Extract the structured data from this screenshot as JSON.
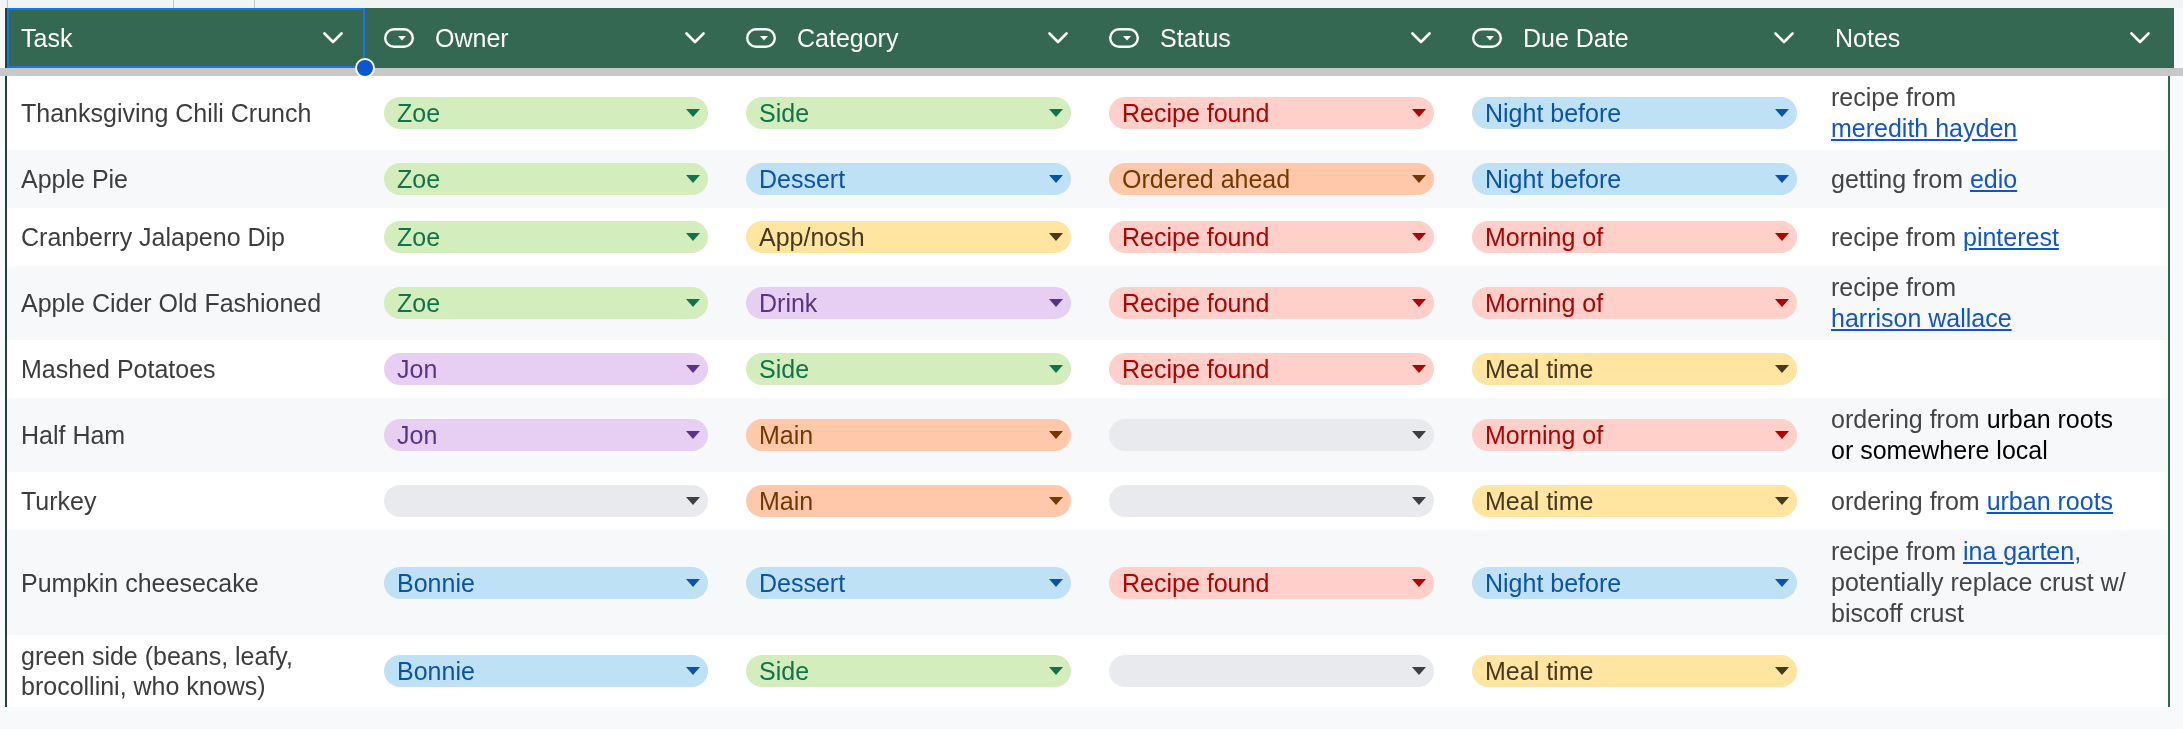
{
  "columns": [
    {
      "label": "Task",
      "kind": "text",
      "selected": true
    },
    {
      "label": "Owner",
      "kind": "dropdown",
      "selected": false
    },
    {
      "label": "Category",
      "kind": "dropdown",
      "selected": false
    },
    {
      "label": "Status",
      "kind": "dropdown",
      "selected": false
    },
    {
      "label": "Due Date",
      "kind": "dropdown",
      "selected": false
    },
    {
      "label": "Notes",
      "kind": "text",
      "selected": false
    }
  ],
  "rows": [
    {
      "task": "Thanksgiving Chili Crunch",
      "owner": {
        "label": "Zoe",
        "color": "#d4edbc"
      },
      "category": {
        "label": "Side",
        "color": "#d4edbc"
      },
      "status": {
        "label": "Recipe found",
        "color": "#ffcfc9"
      },
      "due_date": {
        "label": "Night before",
        "color": "#bfe1f6"
      },
      "notes": [
        {
          "kind": "text",
          "text": "recipe from "
        },
        {
          "kind": "link",
          "text": "meredith hayden"
        }
      ]
    },
    {
      "task": "Apple Pie",
      "owner": {
        "label": "Zoe",
        "color": "#d4edbc"
      },
      "category": {
        "label": "Dessert",
        "color": "#bfe1f6"
      },
      "status": {
        "label": "Ordered ahead",
        "color": "#ffc8aa"
      },
      "due_date": {
        "label": "Night before",
        "color": "#bfe1f6"
      },
      "notes": [
        {
          "kind": "text",
          "text": "getting from "
        },
        {
          "kind": "link",
          "text": "edio"
        }
      ]
    },
    {
      "task": "Cranberry Jalapeno Dip",
      "owner": {
        "label": "Zoe",
        "color": "#d4edbc"
      },
      "category": {
        "label": "App/nosh",
        "color": "#ffe5a0"
      },
      "status": {
        "label": "Recipe found",
        "color": "#ffcfc9"
      },
      "due_date": {
        "label": "Morning of",
        "color": "#ffcfc9"
      },
      "notes": [
        {
          "kind": "text",
          "text": "recipe from "
        },
        {
          "kind": "link",
          "text": "pinterest"
        }
      ]
    },
    {
      "task": "Apple Cider Old Fashioned",
      "owner": {
        "label": "Zoe",
        "color": "#d4edbc"
      },
      "category": {
        "label": "Drink",
        "color": "#e6cff2"
      },
      "status": {
        "label": "Recipe found",
        "color": "#ffcfc9"
      },
      "due_date": {
        "label": "Morning of",
        "color": "#ffcfc9"
      },
      "notes": [
        {
          "kind": "text",
          "text": "recipe from "
        },
        {
          "kind": "link",
          "text": "harrison wallace"
        }
      ]
    },
    {
      "task": "Mashed Potatoes",
      "owner": {
        "label": "Jon",
        "color": "#e6cff2"
      },
      "category": {
        "label": "Side",
        "color": "#d4edbc"
      },
      "status": {
        "label": "Recipe found",
        "color": "#ffcfc9"
      },
      "due_date": {
        "label": "Meal time",
        "color": "#ffe5a0"
      }
    },
    {
      "task": "Half Ham",
      "owner": {
        "label": "Jon",
        "color": "#e6cff2"
      },
      "category": {
        "label": "Main",
        "color": "#ffc8aa"
      },
      "status": {
        "color": "#e8eaed"
      },
      "due_date": {
        "label": "Morning of",
        "color": "#ffcfc9"
      },
      "notes": [
        {
          "kind": "text",
          "text": "ordering from "
        },
        {
          "kind": "dark",
          "text": "urban roots or somewhere local"
        }
      ]
    },
    {
      "task": "Turkey",
      "owner": {
        "color": "#e8eaed"
      },
      "category": {
        "label": "Main",
        "color": "#ffc8aa"
      },
      "status": {
        "color": "#e8eaed"
      },
      "due_date": {
        "label": "Meal time",
        "color": "#ffe5a0"
      },
      "notes": [
        {
          "kind": "text",
          "text": "ordering from "
        },
        {
          "kind": "link",
          "text": "urban roots"
        }
      ]
    },
    {
      "task": "Pumpkin cheesecake",
      "owner": {
        "label": "Bonnie",
        "color": "#bfe1f6"
      },
      "category": {
        "label": "Dessert",
        "color": "#bfe1f6"
      },
      "status": {
        "label": "Recipe found",
        "color": "#ffcfc9"
      },
      "due_date": {
        "label": "Night before",
        "color": "#bfe1f6"
      },
      "notes": [
        {
          "kind": "text",
          "text": "recipe from "
        },
        {
          "kind": "link",
          "text": "ina garten,"
        },
        {
          "kind": "text",
          "text": " potentially replace crust w/ biscoff crust"
        }
      ]
    },
    {
      "task": "green side (beans, leafy, brocollini, who knows)",
      "owner": {
        "label": "Bonnie",
        "color": "#bfe1f6"
      },
      "category": {
        "label": "Side",
        "color": "#d4edbc"
      },
      "status": {
        "color": "#e8eaed"
      },
      "due_date": {
        "label": "Meal time",
        "color": "#ffe5a0"
      }
    }
  ]
}
